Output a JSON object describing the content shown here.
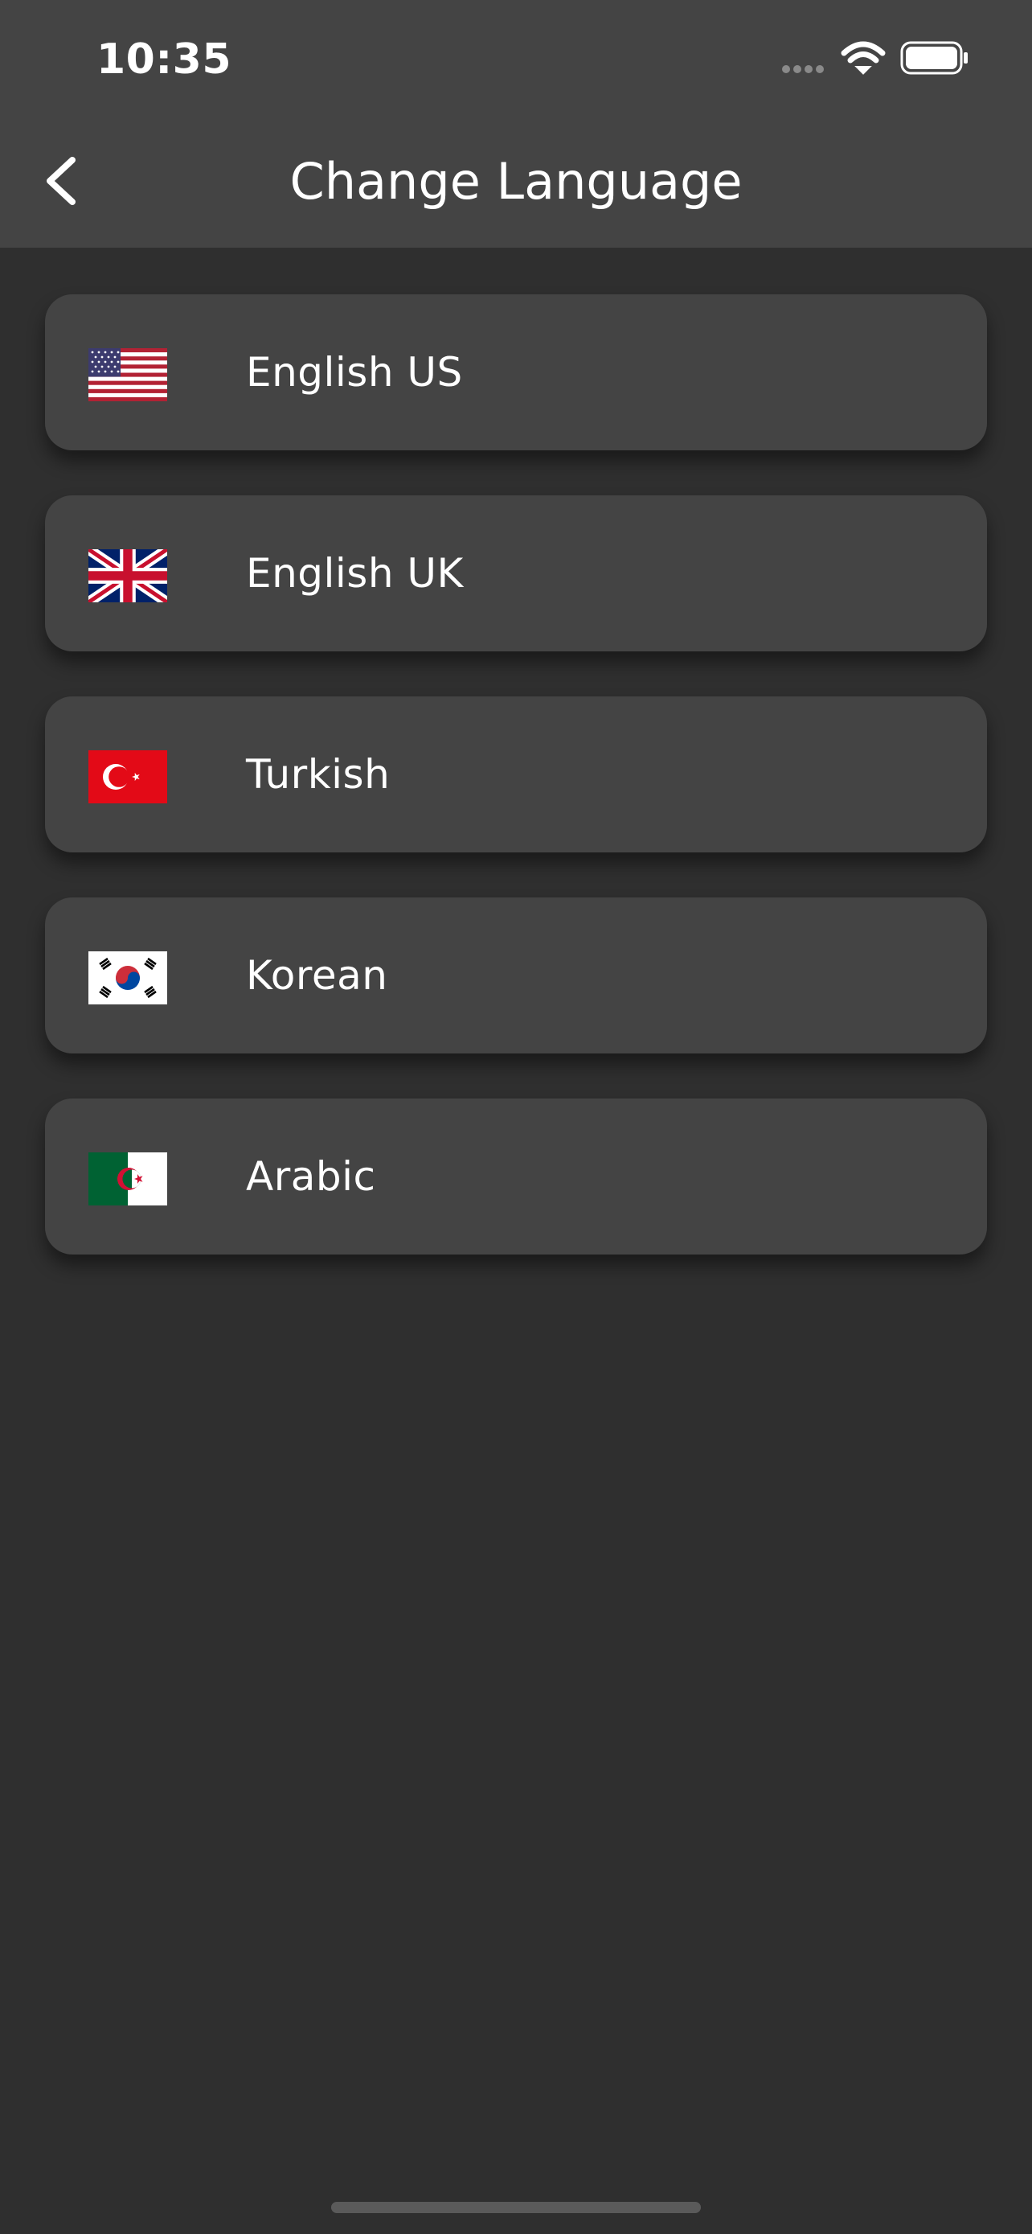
{
  "status_bar": {
    "time": "10:35",
    "icons": [
      "cellular-dots-icon",
      "wifi-icon",
      "battery-icon"
    ]
  },
  "header": {
    "title": "Change Language",
    "back_icon": "chevron-left-icon"
  },
  "languages": [
    {
      "label": "English US",
      "flag": "us-flag-icon"
    },
    {
      "label": "English UK",
      "flag": "uk-flag-icon"
    },
    {
      "label": "Turkish",
      "flag": "turkey-flag-icon"
    },
    {
      "label": "Korean",
      "flag": "korea-flag-icon"
    },
    {
      "label": "Arabic",
      "flag": "algeria-flag-icon"
    }
  ],
  "colors": {
    "background": "#2f2f2f",
    "header_background": "#444444",
    "card_background": "#444444",
    "text": "#ffffff"
  }
}
